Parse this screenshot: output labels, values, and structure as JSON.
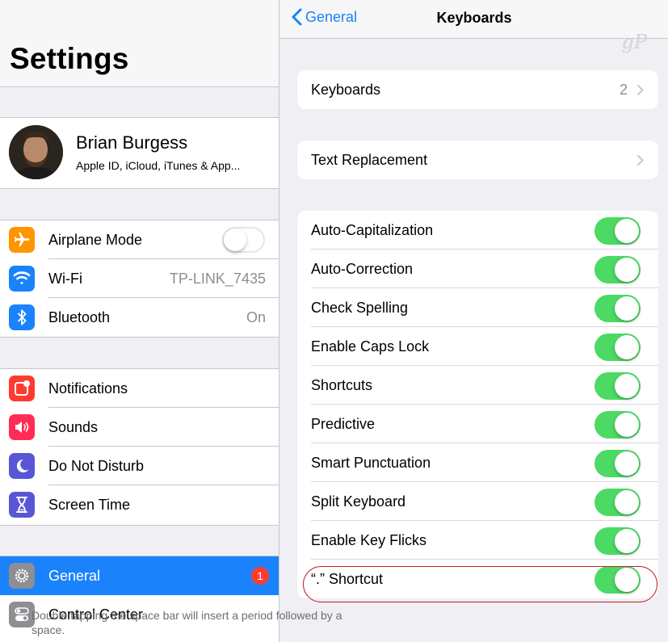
{
  "settings": {
    "title": "Settings",
    "profile": {
      "name": "Brian Burgess",
      "subtitle": "Apple ID, iCloud, iTunes & App..."
    },
    "connectivity": [
      {
        "label": "Airplane Mode",
        "icon": "airplane-icon",
        "color": "#ff9500",
        "toggle": "off"
      },
      {
        "label": "Wi-Fi",
        "icon": "wifi-icon",
        "color": "#1a82fb",
        "value": "TP-LINK_7435"
      },
      {
        "label": "Bluetooth",
        "icon": "bluetooth-icon",
        "color": "#1a82fb",
        "value": "On"
      }
    ],
    "alerts": [
      {
        "label": "Notifications",
        "icon": "notifications-icon",
        "color": "#ff3b30"
      },
      {
        "label": "Sounds",
        "icon": "sounds-icon",
        "color": "#ff2d55"
      },
      {
        "label": "Do Not Disturb",
        "icon": "moon-icon",
        "color": "#5856d6"
      },
      {
        "label": "Screen Time",
        "icon": "hourglass-icon",
        "color": "#5856d6"
      }
    ],
    "system": [
      {
        "label": "General",
        "icon": "gear-icon",
        "color": "#8e8e93",
        "badge": "1",
        "selected": true
      },
      {
        "label": "Control Center",
        "icon": "toggles-icon",
        "color": "#8e8e93"
      }
    ]
  },
  "keyboards": {
    "back_label": "General",
    "title": "Keyboards",
    "watermark": "gP",
    "keyboards_row": {
      "label": "Keyboards",
      "value": "2"
    },
    "text_replacement_label": "Text Replacement",
    "toggles": [
      {
        "label": "Auto-Capitalization",
        "on": true
      },
      {
        "label": "Auto-Correction",
        "on": true
      },
      {
        "label": "Check Spelling",
        "on": true
      },
      {
        "label": "Enable Caps Lock",
        "on": true
      },
      {
        "label": "Shortcuts",
        "on": true
      },
      {
        "label": "Predictive",
        "on": true
      },
      {
        "label": "Smart Punctuation",
        "on": true
      },
      {
        "label": "Split Keyboard",
        "on": true
      },
      {
        "label": "Enable Key Flicks",
        "on": true
      },
      {
        "label": "“.” Shortcut",
        "on": true
      }
    ],
    "footnote": "Double tapping the space bar will insert a period followed by a space."
  },
  "colors": {
    "accent": "#1a82fb",
    "switch_on": "#4cd964",
    "badge": "#ff3b30",
    "highlight": "#c41e24"
  }
}
